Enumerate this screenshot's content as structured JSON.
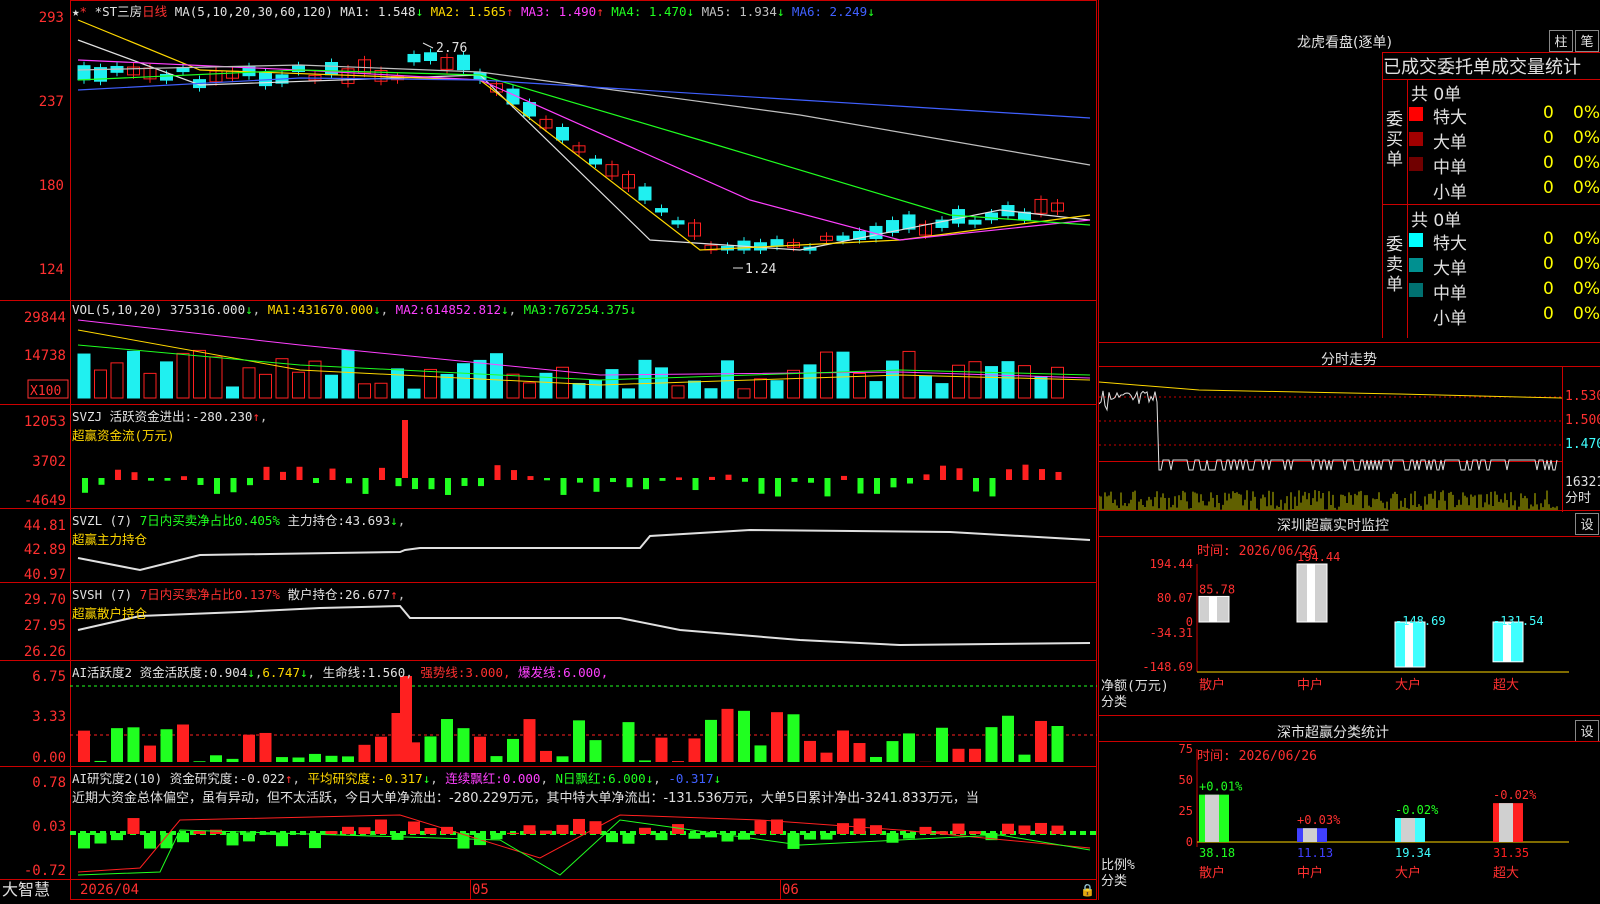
{
  "stock": {
    "name": "*ST三房",
    "period": "日线"
  },
  "price_panel": {
    "ma_header": "MA(5,10,20,30,60,120)",
    "ma": [
      {
        "label": "MA1:",
        "value": "1.548",
        "arrow": "↓",
        "color": "#e0e0e0"
      },
      {
        "label": "MA2:",
        "value": "1.565",
        "arrow": "↑",
        "color": "#ffd800"
      },
      {
        "label": "MA3:",
        "value": "1.490",
        "arrow": "↑",
        "color": "#ff40ff"
      },
      {
        "label": "MA4:",
        "value": "1.470",
        "arrow": "↓",
        "color": "#20ff20"
      },
      {
        "label": "MA5:",
        "value": "1.934",
        "arrow": "↓",
        "color": "#c0c0c0"
      },
      {
        "label": "MA6:",
        "value": "2.249",
        "arrow": "↓",
        "color": "#4060ff"
      }
    ],
    "y_ticks": [
      "293",
      "237",
      "180",
      "124"
    ],
    "high_label": "2.76",
    "low_label": "1.24"
  },
  "vol_panel": {
    "header": "VOL(5,10,20)",
    "value": "375316.000",
    "ma1": "431670.000",
    "ma2": "614852.812",
    "ma3": "767254.375",
    "y_ticks": [
      "29844",
      "14738"
    ],
    "unit": "X100"
  },
  "svzj_panel": {
    "header": "SVZJ",
    "label": "活跃资金进出:",
    "value": "-280.230",
    "sub": "超赢资金流(万元)",
    "y_ticks": [
      "12053",
      "3702",
      "-4649"
    ]
  },
  "svzl_panel": {
    "header": "SVZL (7)",
    "text1": "7日内买卖净占比0.405%",
    "text2": "主力持仓:",
    "value": "43.693",
    "sub": "超赢主力持仓",
    "y_ticks": [
      "44.81",
      "42.89",
      "40.97"
    ]
  },
  "svsh_panel": {
    "header": "SVSH (7)",
    "text1": "7日内买卖净占比0.137%",
    "text2": "散户持仓:",
    "value": "26.677",
    "sub": "超赢散户持仓",
    "y_ticks": [
      "29.70",
      "27.95",
      "26.26"
    ]
  },
  "ai_active": {
    "header": "AI活跃度2",
    "label": "资金活跃度:",
    "v1": "0.904",
    "v2": "6.747",
    "life_label": "生命线:",
    "life": "1.560",
    "strong_label": "强势线:",
    "strong": "3.000",
    "burst_label": "爆发线:",
    "burst": "6.000",
    "y_ticks": [
      "6.75",
      "3.33",
      "0.00"
    ]
  },
  "ai_research": {
    "header": "AI研究度2(10)",
    "label": "资金研究度:",
    "v1": "-0.022",
    "avg_label": "平均研究度:",
    "avg": "-0.317",
    "red_label": "连续飘红:",
    "red": "0.000",
    "nred_label": "N日飘红:",
    "nred": "6.000",
    "v2": "-0.317",
    "comment": "近期大资金总体偏空，虽有异动，但不太活跃，今日大单净流出：-280.229万元，其中特大单净流出：-131.536万元，大单5日累计净出-3241.833万元，当",
    "y_ticks": [
      "0.78",
      "0.03",
      "-0.72"
    ]
  },
  "x_axis": {
    "logo": "大智慧",
    "date": "2026/04",
    "m1": "05",
    "m2": "06"
  },
  "longhu": {
    "title": "龙虎看盘(逐单)",
    "btn1": "柱",
    "btn2": "笔",
    "header": "已成交委托单成交量统计",
    "buy_label": "委买单",
    "sell_label": "委卖单",
    "buy_total": "共 0单",
    "sell_total": "共 0单",
    "buy_rows": [
      {
        "name": "特大",
        "n": "0",
        "p": "0%",
        "color": "#ff0000"
      },
      {
        "name": "大单",
        "n": "0",
        "p": "0%",
        "color": "#a00000"
      },
      {
        "name": "中单",
        "n": "0",
        "p": "0%",
        "color": "#700000"
      },
      {
        "name": "小单",
        "n": "0",
        "p": "0%",
        "color": "#000000"
      }
    ],
    "sell_rows": [
      {
        "name": "特大",
        "n": "0",
        "p": "0%",
        "color": "#00ffff"
      },
      {
        "name": "大单",
        "n": "0",
        "p": "0%",
        "color": "#009090"
      },
      {
        "name": "中单",
        "n": "0",
        "p": "0%",
        "color": "#007070"
      },
      {
        "name": "小单",
        "n": "0",
        "p": "0%",
        "color": "#000000"
      }
    ]
  },
  "fenshi": {
    "title": "分时走势",
    "y_labels": [
      "1.530",
      "1.500",
      "1.470"
    ],
    "vol_label": "16321",
    "sub": "分时"
  },
  "sz_monitor": {
    "title": "深圳超赢实时监控",
    "btn": "设",
    "time": "时间: 2026/06/26",
    "y_ticks": [
      "194.44",
      "80.07",
      "0",
      "-34.31",
      "-148.69"
    ],
    "axis_label1": "净额(万元)",
    "axis_label2": "分类",
    "bars": [
      {
        "name": "散户",
        "value": 85.78,
        "label": "85.78"
      },
      {
        "name": "中户",
        "value": 194.44,
        "label": "194.44"
      },
      {
        "name": "大户",
        "value": -148.69,
        "label": "-148.69"
      },
      {
        "name": "超大",
        "value": -131.54,
        "label": "-131.54"
      }
    ]
  },
  "sz_class": {
    "title": "深市超赢分类统计",
    "btn": "设",
    "time": "时间: 2026/06/26",
    "y_ticks": [
      "75",
      "50",
      "25",
      "0"
    ],
    "axis_label1": "比例%",
    "axis_label2": "分类",
    "bars": [
      {
        "name": "散户",
        "value": 38.18,
        "label": "38.18",
        "change": "+0.01%"
      },
      {
        "name": "中户",
        "value": 11.13,
        "label": "11.13",
        "change": "+0.03%"
      },
      {
        "name": "大户",
        "value": 19.34,
        "label": "19.34",
        "change": "-0.02%"
      },
      {
        "name": "超大",
        "value": 31.35,
        "label": "31.35",
        "change": "-0.02%"
      }
    ]
  }
}
